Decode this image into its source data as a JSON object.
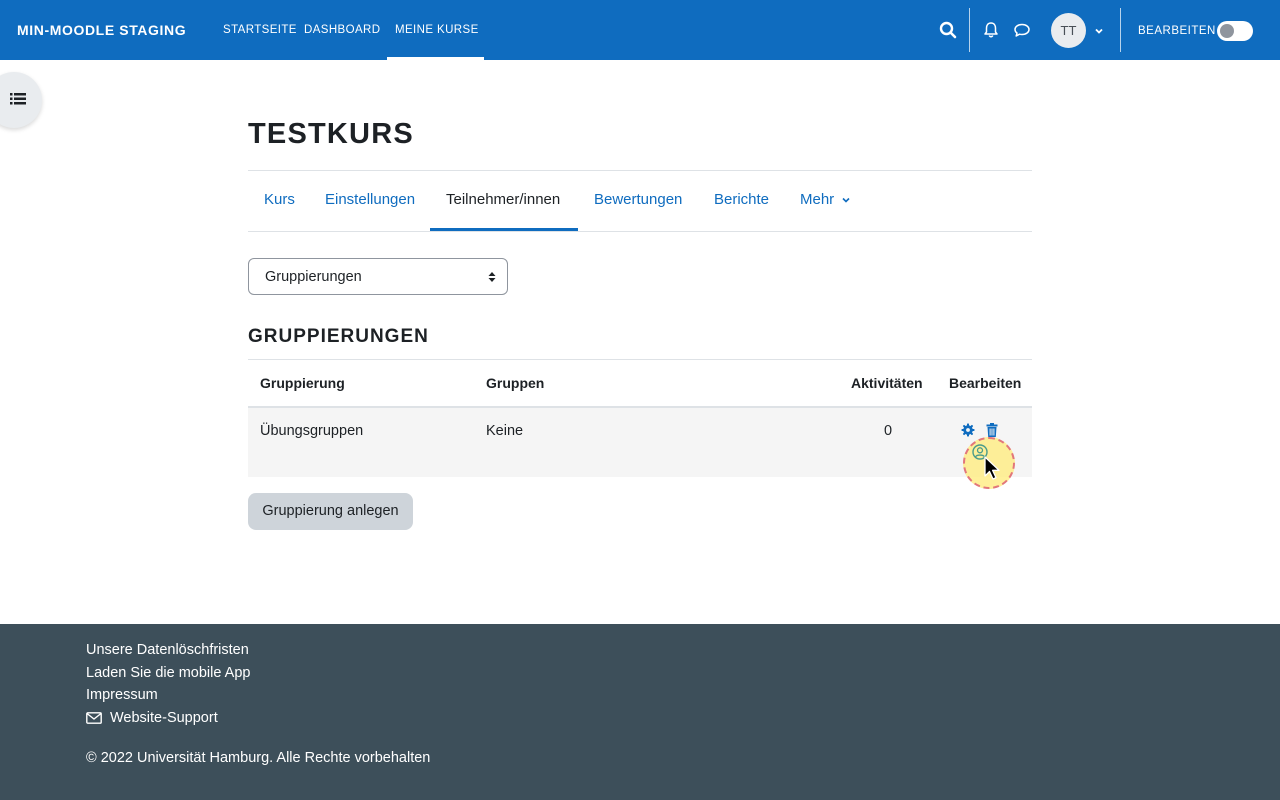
{
  "navbar": {
    "brand": "MIN-MOODLE STAGING",
    "links": [
      "STARTSEITE",
      "DASHBOARD",
      "MEINE KURSE"
    ],
    "avatar_initials": "TT",
    "edit_mode_label": "BEARBEITEN",
    "edit_mode_on": false
  },
  "course": {
    "title": "TESTKURS",
    "tabs": [
      "Kurs",
      "Einstellungen",
      "Teilnehmer/innen",
      "Bewertungen",
      "Berichte",
      "Mehr"
    ],
    "active_tab": "Teilnehmer/innen"
  },
  "selector": {
    "value": "Gruppierungen"
  },
  "section": {
    "heading": "GRUPPIERUNGEN",
    "table": {
      "headers": [
        "Gruppierung",
        "Gruppen",
        "Aktivitäten",
        "Bearbeiten"
      ],
      "rows": [
        {
          "gruppierung": "Übungsgruppen",
          "gruppen": "Keine",
          "aktivitaeten": "0"
        }
      ]
    },
    "create_button": "Gruppierung anlegen"
  },
  "footer": {
    "links": [
      "Unsere Datenlöschfristen",
      "Laden Sie die mobile App",
      "Impressum",
      "Website-Support"
    ],
    "copyright": "© 2022 Universität Hamburg. Alle Rechte vorbehalten"
  },
  "colors": {
    "primary": "#0f6cbf",
    "footer_bg": "#3d4f5a",
    "row_bg": "#f5f5f5",
    "button_secondary": "#ced4da"
  },
  "icons": [
    "search-icon",
    "bell-icon",
    "chat-icon",
    "chevron-down-icon",
    "course-index-icon",
    "sort-arrows-icon",
    "gear-icon",
    "trash-icon",
    "user-icon",
    "mail-icon",
    "mouse-cursor-icon"
  ]
}
